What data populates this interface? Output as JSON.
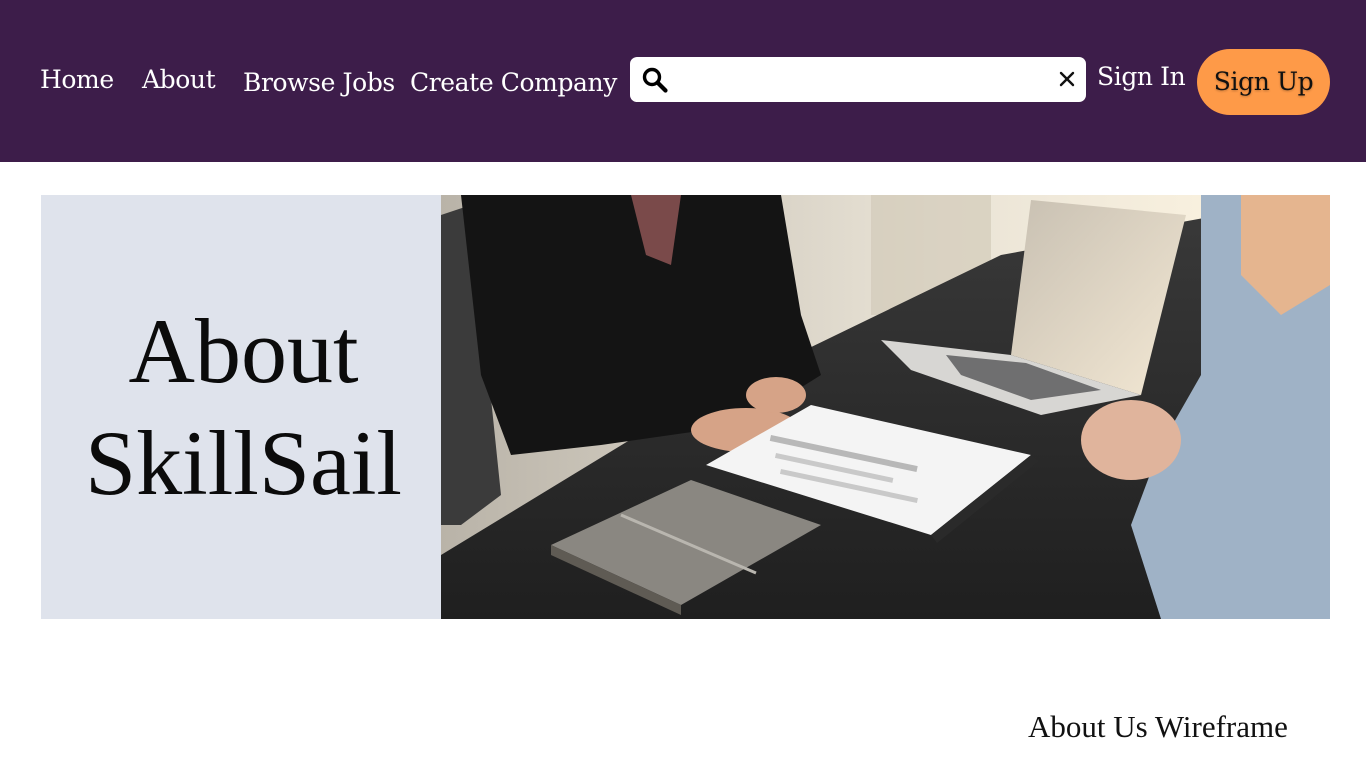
{
  "nav": {
    "home": "Home",
    "about": "About",
    "browse_jobs": "Browse Jobs",
    "create_company": "Create Company",
    "sign_in": "Sign In",
    "sign_up": "Sign Up"
  },
  "search": {
    "value": "",
    "icon": "search-icon",
    "clear_icon": "close-icon"
  },
  "hero": {
    "title_line1": "About",
    "title_line2": "SkillSail",
    "image": "job-interview-photo"
  },
  "section": {
    "label": "About Us Wireframe"
  },
  "colors": {
    "header_bg": "#3d1d4a",
    "signup_bg": "#fe9a48",
    "hero_panel_bg": "#dfe3ec"
  }
}
